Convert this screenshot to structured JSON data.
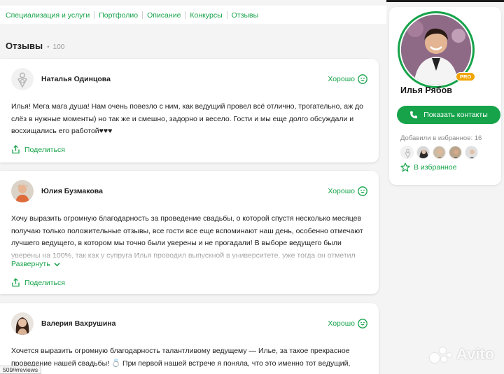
{
  "nav": {
    "items": [
      "Специализация и услуги",
      "Портфолио",
      "Описание",
      "Конкурсы",
      "Отзывы"
    ]
  },
  "reviews_section": {
    "title": "Отзывы",
    "dot": "•",
    "count": "100"
  },
  "reviews": [
    {
      "author": "Наталья Одинцова",
      "rating": "Хорошо",
      "avatar": "default-ring-avatar",
      "text": "Илья! Мега мага душа! Нам очень повезло с ним, как ведущий провел всё отлично, трогательно, аж до слёз в нужные моменты) но так же и смешно, задорно и весело. Гости и мы еще долго обсуждали и восхищались его работой♥♥♥",
      "share": "Поделиться"
    },
    {
      "author": "Юлия Бузмакова",
      "rating": "Хорошо",
      "avatar": "photo-avatar",
      "text": "Хочу выразить огромную благодарность за проведение свадьбы, о которой спустя несколько месяцев получаю только положительные отзывы, все гости все еще вспоминают наш день, особенно отмечают лучшего ведущего, в котором мы точно были уверены и не прогадали! В выборе ведущего были уверены на 100%, так как у супруга Илья проводил выпускной в университете, уже тогда он отметил",
      "expand": "Развернуть",
      "share": "Поделиться"
    },
    {
      "author": "Валерия Вахрушина",
      "rating": "Хорошо",
      "avatar": "photo-avatar",
      "text": "Хочется выразить огромную благодарность талантливому ведущему — Илье, за такое прекрасное проведение нашей свадьбы! 💍 При первой нашей встрече я поняла, что это именно тот ведущий,",
      "share": "Поделиться"
    }
  ],
  "profile": {
    "name": "Илья Рябов",
    "badge": "PRO",
    "contact_button": "Показать контакты",
    "favorites_label": "Добавили в избранное: 16",
    "favorites_button": "В избранное"
  },
  "status_url": "509/#reviews",
  "watermark": "Avito",
  "colors": {
    "accent": "#16a34a",
    "pro_badge": "#f0a500"
  }
}
